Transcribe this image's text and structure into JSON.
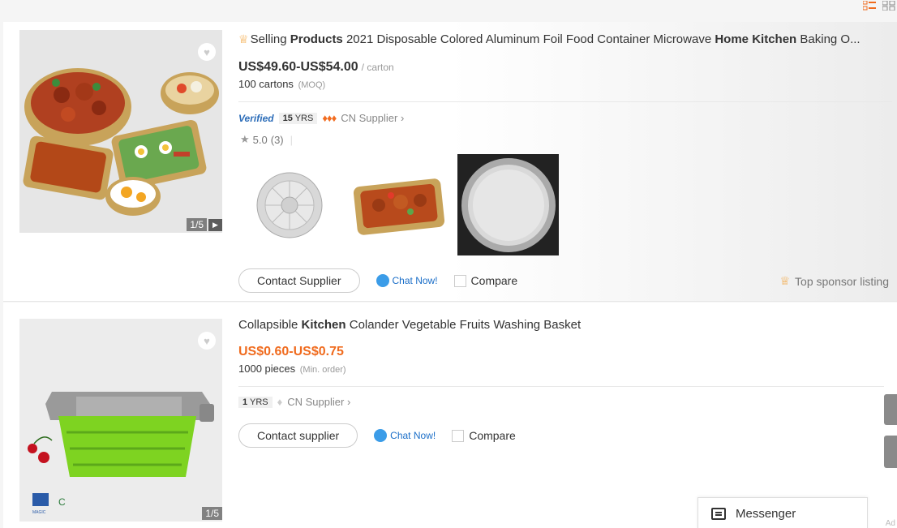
{
  "colors": {
    "accent": "#f06b1e",
    "chat": "#1a6ec8",
    "verified": "#2b6cb8",
    "diamond": "#f26d21",
    "crown": "#f3a43b"
  },
  "view_icons": [
    "list-view-icon",
    "grid-view-icon"
  ],
  "products": [
    {
      "title_prefix": "Selling ",
      "title_b1": "Products",
      "title_mid": " 2021 Disposable Colored Aluminum Foil Food Container Microwave ",
      "title_b2": "Home",
      "title_sp": " ",
      "title_b3": "Kitchen",
      "title_end": " Baking O...",
      "price": "US$49.60-US$54.00",
      "price_unit": "/ carton",
      "moq_value": "100 cartons",
      "moq_label": "(MOQ)",
      "verified": "Verified",
      "years": "15",
      "years_unit": "YRS",
      "supplier_country": "CN Supplier",
      "rating": "5.0",
      "reviews": "(3)",
      "image_counter": "1/5",
      "contact_label": "Contact Supplier",
      "chat_label": "Chat Now!",
      "compare_label": "Compare",
      "sponsor_label": "Top sponsor listing"
    },
    {
      "title_a": "Collapsible ",
      "title_b": "Kitchen",
      "title_c": " Colander Vegetable Fruits Washing Basket",
      "price": "US$0.60-US$0.75",
      "moq_value": "1000 pieces",
      "moq_label": "(Min. order)",
      "years": "1",
      "years_unit": "YRS",
      "supplier_country": "CN Supplier",
      "image_counter": "1/5",
      "contact_label": "Contact supplier",
      "chat_label": "Chat Now!",
      "compare_label": "Compare"
    }
  ],
  "messenger": {
    "label": "Messenger"
  },
  "side_tabs": [
    "side-tab-1",
    "side-tab-2"
  ],
  "ad_label": "Ad"
}
